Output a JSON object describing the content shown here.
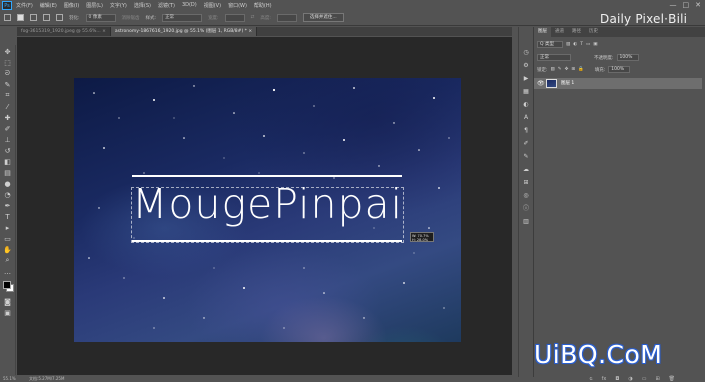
{
  "menubar": {
    "logo": "Ps",
    "items": [
      "文件(F)",
      "编辑(E)",
      "图像(I)",
      "图层(L)",
      "文字(Y)",
      "选择(S)",
      "滤镜(T)",
      "3D(D)",
      "视图(V)",
      "窗口(W)",
      "帮助(H)"
    ]
  },
  "window_controls": {
    "minimize": "—",
    "maximize": "□",
    "close": "✕"
  },
  "options": {
    "feather_label": "羽化:",
    "feather_value": "0 像素",
    "antialias_label": "消除锯齿",
    "style_label": "样式:",
    "style_value": "正常",
    "width_label": "宽度:",
    "height_label": "高度:",
    "select_mask_button": "选择并遮住..."
  },
  "watermark_top": "Daily Pixel·Bili",
  "tabs": [
    {
      "label": "fog-3615319_1920.jpeg @ 55.6%...",
      "close": "×"
    },
    {
      "label": "astronomy-1867616_1920.jpg @ 55.1% (图层 1, RGB/8#) *",
      "close": "×"
    }
  ],
  "canvas": {
    "title": "MougePinpai",
    "readout_w": "W: 70.7%",
    "readout_h": "H: 28.0%"
  },
  "statusbar": {
    "zoom": "55.1%",
    "doc": "文档:5.27M/7.25M"
  },
  "layers_panel": {
    "tabs": [
      "图层",
      "通道",
      "路径",
      "历史"
    ],
    "kind_label": "Q 类型",
    "blend_mode": "正常",
    "opacity_label": "不透明度:",
    "opacity_value": "100%",
    "lock_label": "锁定:",
    "fill_label": "填充:",
    "fill_value": "100%",
    "layer_name": "图层 1",
    "bottom_icons": [
      "ɢ",
      "fx",
      "◘",
      "◑",
      "▭",
      "⊞",
      "🗑"
    ]
  },
  "watermark_bottom": "UiBQ.CoM"
}
